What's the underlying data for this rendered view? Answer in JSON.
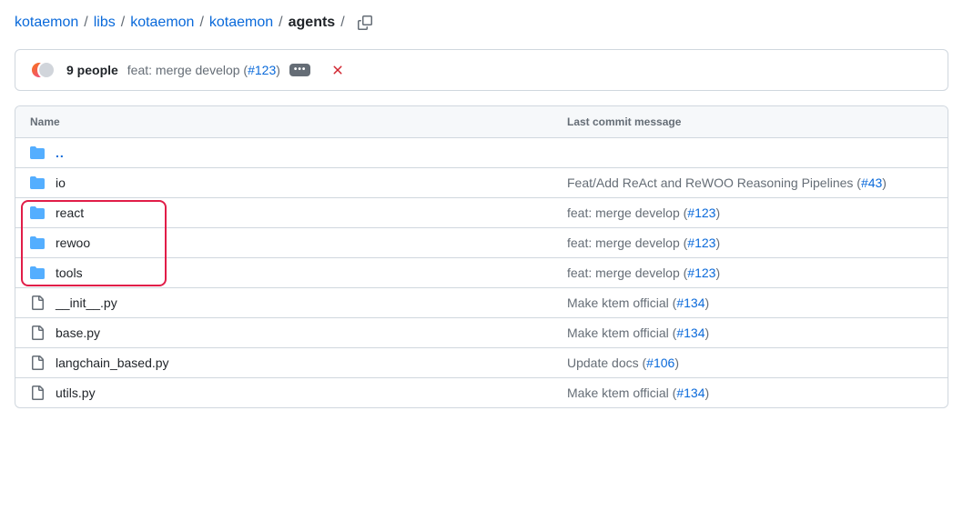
{
  "breadcrumb": {
    "parts": [
      {
        "label": "kotaemon",
        "final": false
      },
      {
        "label": "libs",
        "final": false
      },
      {
        "label": "kotaemon",
        "final": false
      },
      {
        "label": "kotaemon",
        "final": false
      },
      {
        "label": "agents",
        "final": true
      }
    ],
    "sep": "/"
  },
  "commit_bar": {
    "people_label": "9 people",
    "message": "feat: merge develop (",
    "pr_label": "#123",
    "close_paren": ")"
  },
  "headers": {
    "name": "Name",
    "last_commit": "Last commit message"
  },
  "parent_label": "..",
  "rows": [
    {
      "type": "folder",
      "name": "io",
      "msg": "Feat/Add ReAct and ReWOO Reasoning Pipelines (",
      "pr": "#43",
      "close": ")",
      "highlight": false
    },
    {
      "type": "folder",
      "name": "react",
      "msg": "feat: merge develop (",
      "pr": "#123",
      "close": ")",
      "highlight": true
    },
    {
      "type": "folder",
      "name": "rewoo",
      "msg": "feat: merge develop (",
      "pr": "#123",
      "close": ")",
      "highlight": true
    },
    {
      "type": "folder",
      "name": "tools",
      "msg": "feat: merge develop (",
      "pr": "#123",
      "close": ")",
      "highlight": true
    },
    {
      "type": "file",
      "name": "__init__.py",
      "msg": "Make ktem official (",
      "pr": "#134",
      "close": ")",
      "highlight": false
    },
    {
      "type": "file",
      "name": "base.py",
      "msg": "Make ktem official (",
      "pr": "#134",
      "close": ")",
      "highlight": false
    },
    {
      "type": "file",
      "name": "langchain_based.py",
      "msg": "Update docs (",
      "pr": "#106",
      "close": ")",
      "highlight": false
    },
    {
      "type": "file",
      "name": "utils.py",
      "msg": "Make ktem official (",
      "pr": "#134",
      "close": ")",
      "highlight": false
    }
  ]
}
